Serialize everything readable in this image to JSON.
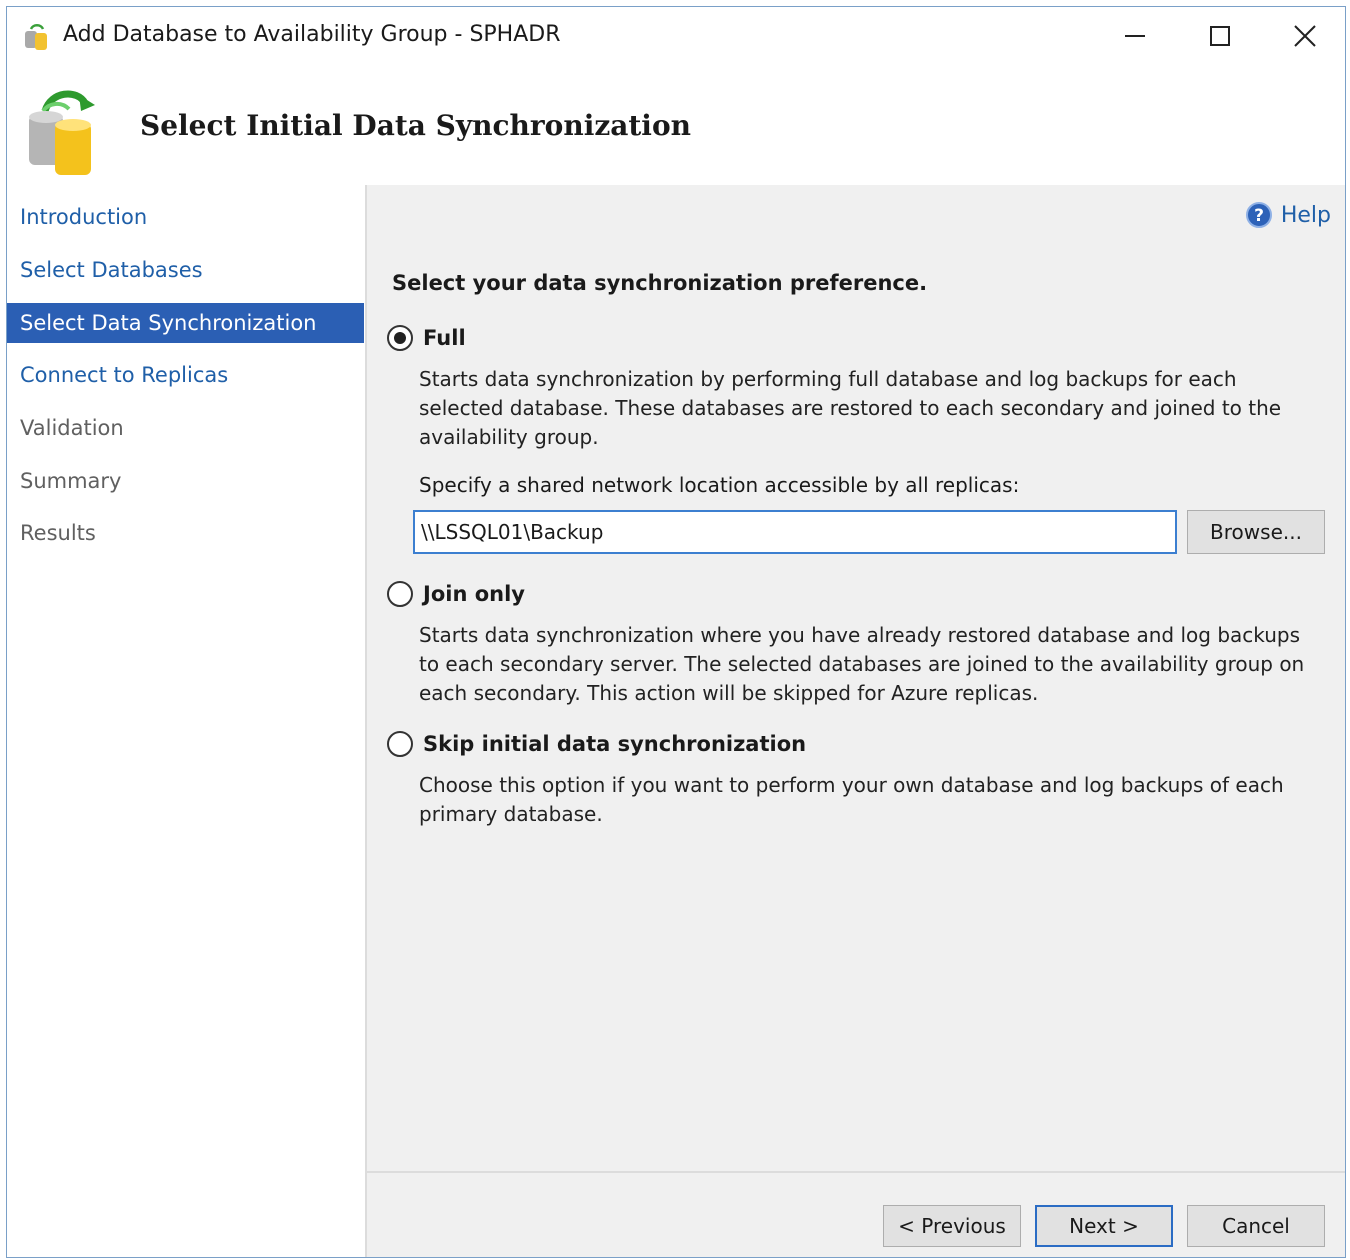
{
  "window": {
    "title": "Add Database to Availability Group - SPHADR"
  },
  "header": {
    "title": "Select Initial Data Synchronization"
  },
  "sidebar": {
    "items": [
      {
        "label": "Introduction",
        "state": "link"
      },
      {
        "label": "Select Databases",
        "state": "link"
      },
      {
        "label": "Select Data Synchronization",
        "state": "active"
      },
      {
        "label": "Connect to Replicas",
        "state": "link"
      },
      {
        "label": "Validation",
        "state": "disabled"
      },
      {
        "label": "Summary",
        "state": "disabled"
      },
      {
        "label": "Results",
        "state": "disabled"
      }
    ]
  },
  "main": {
    "help_label": "Help",
    "heading": "Select your data synchronization preference.",
    "options": [
      {
        "label": "Full",
        "selected": true,
        "description": "Starts data synchronization by performing full database and log backups for each selected database. These databases are restored to each secondary and joined to the availability group."
      },
      {
        "label": "Join only",
        "selected": false,
        "description": "Starts data synchronization where you have already restored database and log backups to each secondary server. The selected databases are joined to the availability group on each secondary. This action will be skipped for Azure replicas."
      },
      {
        "label": "Skip initial data synchronization",
        "selected": false,
        "description": "Choose this option if you want to perform your own database and log backups of each primary database."
      }
    ],
    "location_label": "Specify a shared network location accessible by all replicas:",
    "location_value": "\\\\LSSQL01\\Backup",
    "browse_label": "Browse..."
  },
  "footer": {
    "previous_label": "< Previous",
    "next_label": "Next >",
    "cancel_label": "Cancel"
  },
  "colors": {
    "accent": "#2b5fb4",
    "link": "#1f5fa8",
    "panel": "#f0f0f0"
  }
}
